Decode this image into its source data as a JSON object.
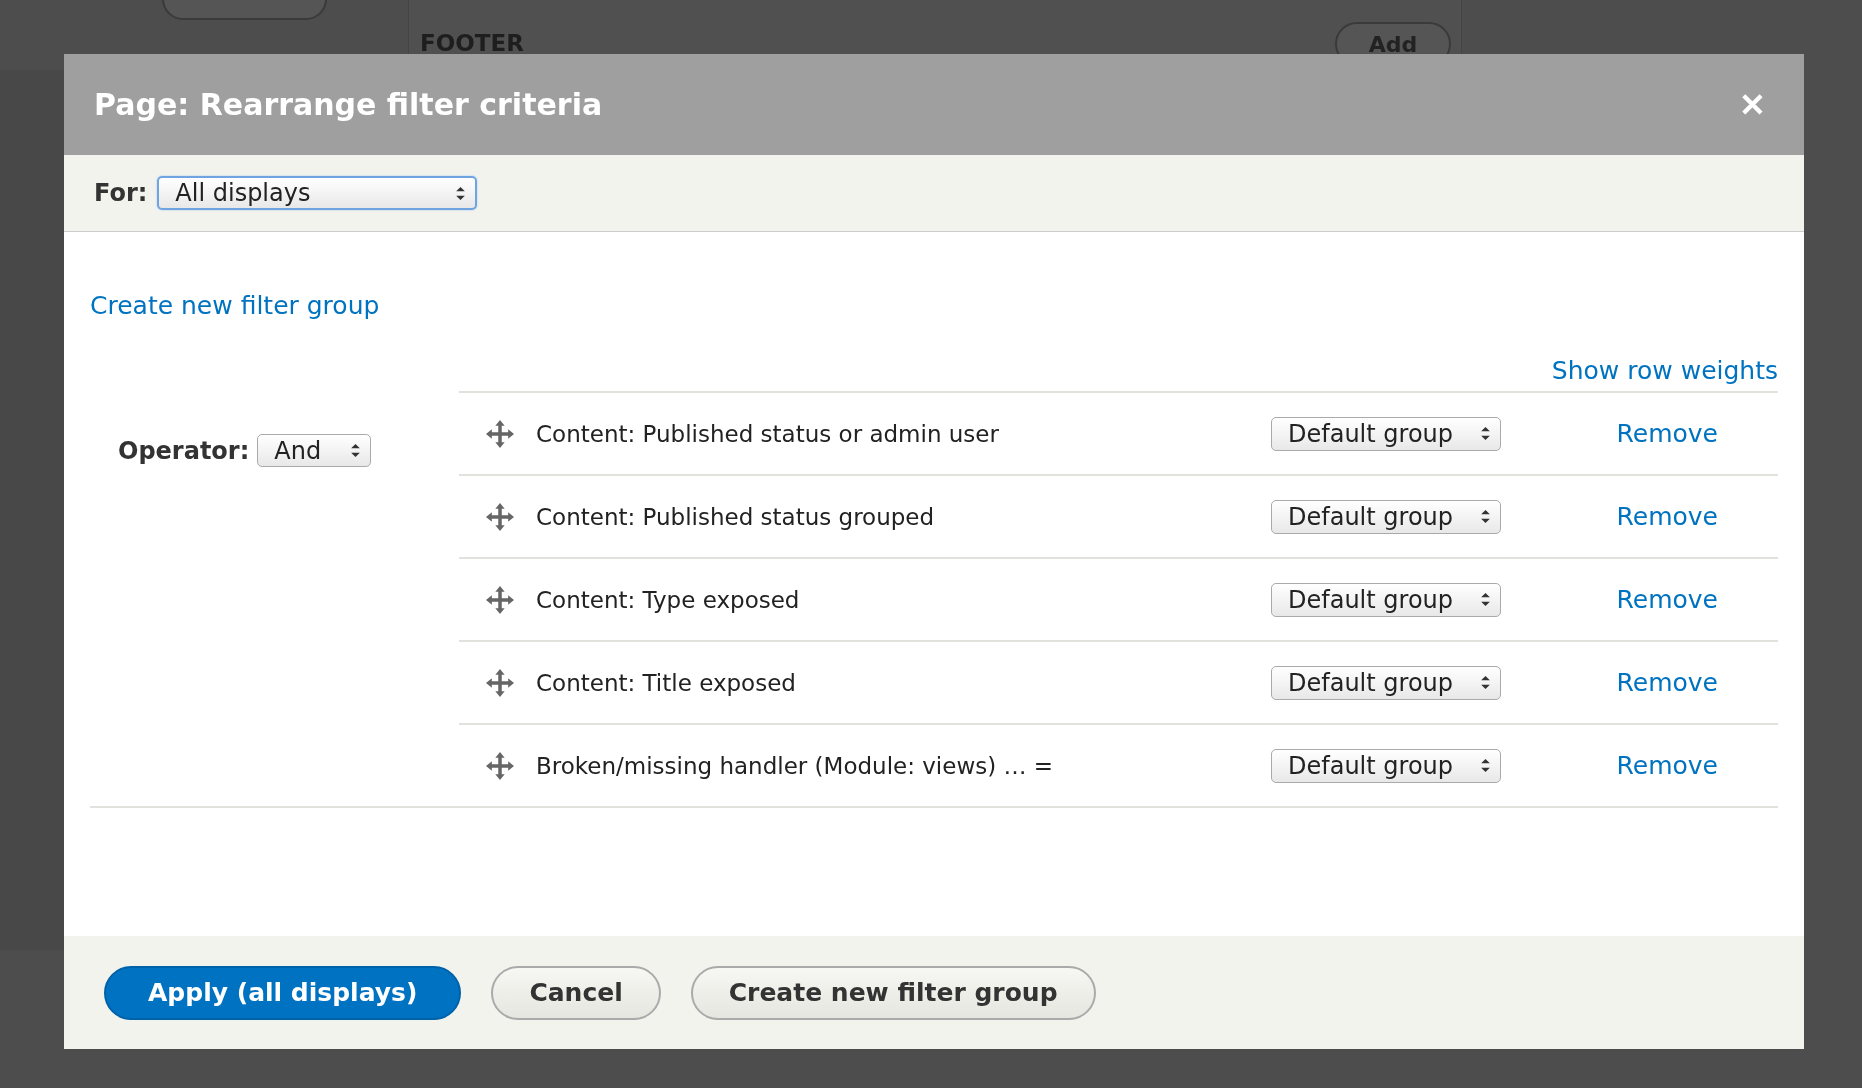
{
  "background": {
    "section_label": "FOOTER",
    "buttons": [
      "Add"
    ]
  },
  "dialog": {
    "title": "Page: Rearrange filter criteria",
    "close_label": "✕"
  },
  "for_bar": {
    "label": "For:",
    "value": "All displays"
  },
  "create_link": "Create new filter group",
  "show_weights_link": "Show row weights",
  "operator": {
    "label": "Operator:",
    "value": "And"
  },
  "filters": [
    {
      "label": "Content: Published status or admin user",
      "group": "Default group",
      "action": "Remove"
    },
    {
      "label": "Content: Published status grouped",
      "group": "Default group",
      "action": "Remove"
    },
    {
      "label": "Content: Type exposed",
      "group": "Default group",
      "action": "Remove"
    },
    {
      "label": "Content: Title exposed",
      "group": "Default group",
      "action": "Remove"
    },
    {
      "label": "Broken/missing handler (Module: views) … =",
      "group": "Default group",
      "action": "Remove"
    }
  ],
  "buttons": [
    {
      "label": "Apply (all displays)",
      "kind": "primary"
    },
    {
      "label": "Cancel",
      "kind": "secondary"
    },
    {
      "label": "Create new filter group",
      "kind": "secondary"
    }
  ]
}
